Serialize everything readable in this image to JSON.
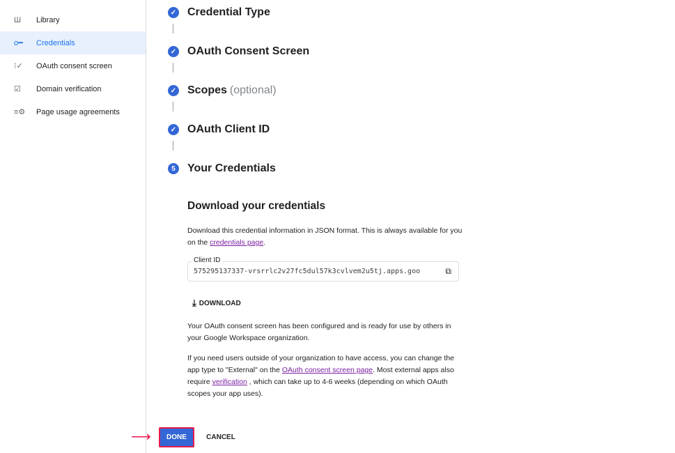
{
  "sidebar": {
    "items": [
      {
        "label": "Library",
        "icon": "library-icon",
        "active": false
      },
      {
        "label": "Credentials",
        "icon": "key-icon",
        "active": true
      },
      {
        "label": "OAuth consent screen",
        "icon": "consent-icon",
        "active": false
      },
      {
        "label": "Domain verification",
        "icon": "checkbox-icon",
        "active": false
      },
      {
        "label": "Page usage agreements",
        "icon": "settings-list-icon",
        "active": false
      }
    ]
  },
  "steps": [
    {
      "label": "Credential Type",
      "done": true
    },
    {
      "label": "OAuth Consent Screen",
      "done": true
    },
    {
      "label": "Scopes",
      "optional": "(optional)",
      "done": true
    },
    {
      "label": "OAuth Client ID",
      "done": true
    },
    {
      "label": "Your Credentials",
      "number": "5",
      "done": false
    }
  ],
  "download": {
    "heading": "Download your credentials",
    "intro": "Download this credential information in JSON format. This is always available for you on the",
    "intro_link": "credentials page",
    "intro_end": ".",
    "client_id_label": "Client ID",
    "client_id_value": "575295137337-vrsrrlc2v27fc5dul57k3cvlvem2u5tj.apps.goo",
    "download_label": "DOWNLOAD",
    "para1": "Your OAuth consent screen has been configured and is ready for use by others in your Google Workspace organization.",
    "para2_a": "If you need users outside of your organization to have access, you can change the app type to \"External\" on the",
    "para2_link1": "OAuth consent screen page",
    "para2_b": ". Most external apps also require",
    "para2_link2": "verification",
    "para2_c": ", which can take up to 4-6 weeks (depending on which OAuth scopes your app uses)."
  },
  "actions": {
    "done": "DONE",
    "cancel": "CANCEL"
  },
  "colors": {
    "accent": "#3367d6",
    "highlight": "#e8194d",
    "link": "#7b1fa2"
  }
}
